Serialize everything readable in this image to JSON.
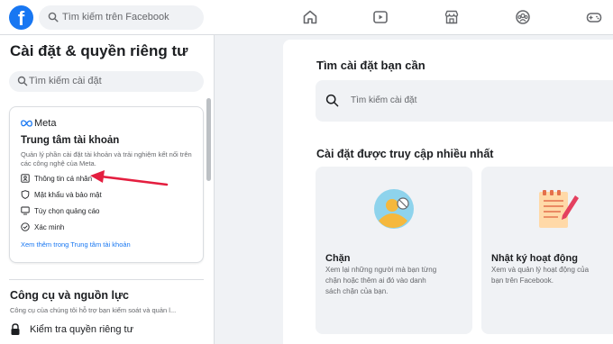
{
  "topbar": {
    "logo_letter": "f",
    "search_placeholder": "Tìm kiếm trên Facebook"
  },
  "sidebar": {
    "title": "Cài đặt & quyền riêng tư",
    "search_placeholder": "Tìm kiếm cài đặt",
    "accounts_center": {
      "meta_label": "Meta",
      "heading": "Trung tâm tài khoản",
      "description": "Quản lý phần cài đặt tài khoản và trải nghiệm kết nối trên các công nghệ của Meta.",
      "items": [
        {
          "label": "Thông tin cá nhân",
          "icon": "id-card-icon"
        },
        {
          "label": "Mật khẩu và bảo mật",
          "icon": "shield-icon"
        },
        {
          "label": "Tùy chọn quảng cáo",
          "icon": "monitor-icon"
        },
        {
          "label": "Xác minh",
          "icon": "check-circle-icon"
        }
      ],
      "link": "Xem thêm trong Trung tâm tài khoản"
    },
    "tools": {
      "title": "Công cụ và nguồn lực",
      "description": "Công cụ của chúng tôi hỗ trợ bạn kiểm soát và quản l...",
      "privacy_check": "Kiểm tra quyền riêng tư"
    }
  },
  "main": {
    "find_title": "Tìm cài đặt bạn cần",
    "search_placeholder": "Tìm kiếm cài đặt",
    "most_visited_title": "Cài đặt được truy cập nhiều nhất",
    "tiles": [
      {
        "title": "Chặn",
        "description": [
          "Xem lại những người mà bạn từng",
          "chặn hoặc thêm ai đó vào danh",
          "sách chặn của bạn."
        ]
      },
      {
        "title": "Nhật ký hoạt động",
        "description": [
          "Xem và quản lý hoạt động của",
          "bạn trên Facebook."
        ]
      }
    ]
  },
  "colors": {
    "brand": "#1877f2",
    "annotation_arrow": "#e41e3f"
  }
}
